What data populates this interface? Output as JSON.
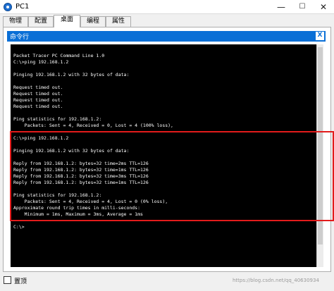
{
  "window": {
    "title": "PC1",
    "minimize": "—",
    "maximize": "☐",
    "close": "✕"
  },
  "tabs": [
    {
      "label": "物理",
      "active": false
    },
    {
      "label": "配置",
      "active": false
    },
    {
      "label": "桌面",
      "active": true
    },
    {
      "label": "编程",
      "active": false
    },
    {
      "label": "属性",
      "active": false
    }
  ],
  "cmd": {
    "title": "命令行",
    "close_label": "X"
  },
  "terminal_lines": [
    "Packet Tracer PC Command Line 1.0",
    "C:\\>ping 192.168.1.2",
    "",
    "Pinging 192.168.1.2 with 32 bytes of data:",
    "",
    "Request timed out.",
    "Request timed out.",
    "Request timed out.",
    "Request timed out.",
    "",
    "Ping statistics for 192.168.1.2:",
    "    Packets: Sent = 4, Received = 0, Lost = 4 (100% loss),",
    "",
    "C:\\>ping 192.168.1.2",
    "",
    "Pinging 192.168.1.2 with 32 bytes of data:",
    "",
    "Reply from 192.168.1.2: bytes=32 time=2ms TTL=126",
    "Reply from 192.168.1.2: bytes=32 time=1ms TTL=126",
    "Reply from 192.168.1.2: bytes=32 time=3ms TTL=126",
    "Reply from 192.168.1.2: bytes=32 time=1ms TTL=126",
    "",
    "Ping statistics for 192.168.1.2:",
    "    Packets: Sent = 4, Received = 4, Lost = 0 (0% loss),",
    "Approximate round trip times in milli-seconds:",
    "    Minimum = 1ms, Maximum = 3ms, Average = 1ms",
    "",
    "C:\\>"
  ],
  "footer": {
    "checkbox_label": "置顶",
    "watermark": "https://blog.csdn.net/qq_40630934"
  }
}
